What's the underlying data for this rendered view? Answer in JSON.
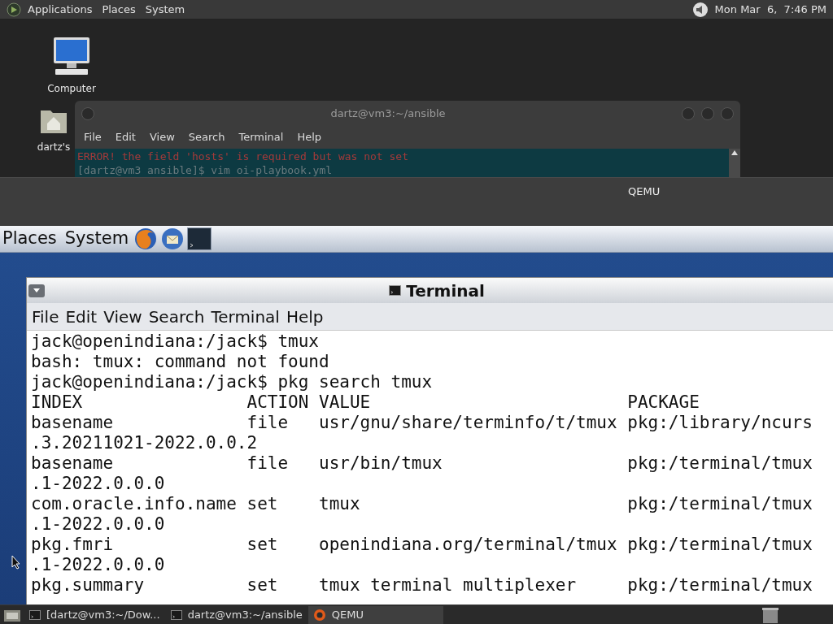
{
  "top_panel": {
    "menus": [
      "Applications",
      "Places",
      "System"
    ],
    "clock": "Mon Mar  6,  7:46 PM"
  },
  "desktop_icons": [
    {
      "label": "Computer",
      "kind": "computer"
    },
    {
      "label": "dartz's",
      "kind": "home"
    }
  ],
  "host_terminal": {
    "title": "dartz@vm3:~/ansible",
    "menus": [
      "File",
      "Edit",
      "View",
      "Search",
      "Terminal",
      "Help"
    ],
    "lines": [
      {
        "text": "ERROR! the field 'hosts' is required but was not set",
        "kind": "error"
      },
      {
        "text": "[dartz@vm3 ansible]$ vim oi-playbook.yml",
        "kind": "prompt"
      }
    ]
  },
  "qemu": {
    "title": "QEMU"
  },
  "guest_panel": {
    "menus": [
      "Places",
      "System"
    ]
  },
  "guest_terminal": {
    "title": "Terminal",
    "menus": [
      "File",
      "Edit",
      "View",
      "Search",
      "Terminal",
      "Help"
    ],
    "lines": [
      "jack@openindiana:/jack$ tmux",
      "bash: tmux: command not found",
      "jack@openindiana:/jack$ pkg search tmux",
      "INDEX                ACTION VALUE                         PACKAGE",
      "basename             file   usr/gnu/share/terminfo/t/tmux pkg:/library/ncurs",
      ".3.20211021-2022.0.0.2",
      "basename             file   usr/bin/tmux                  pkg:/terminal/tmux",
      ".1-2022.0.0.0",
      "com.oracle.info.name set    tmux                          pkg:/terminal/tmux",
      ".1-2022.0.0.0",
      "pkg.fmri             set    openindiana.org/terminal/tmux pkg:/terminal/tmux",
      ".1-2022.0.0.0",
      "pkg.summary          set    tmux terminal multiplexer     pkg:/terminal/tmux"
    ]
  },
  "taskbar": {
    "tasks": [
      {
        "label": "[dartz@vm3:~/Dow...",
        "kind": "terminal",
        "selected": false
      },
      {
        "label": "dartz@vm3:~/ansible",
        "kind": "terminal",
        "selected": false
      },
      {
        "label": "QEMU",
        "kind": "qemu",
        "selected": true
      }
    ]
  }
}
